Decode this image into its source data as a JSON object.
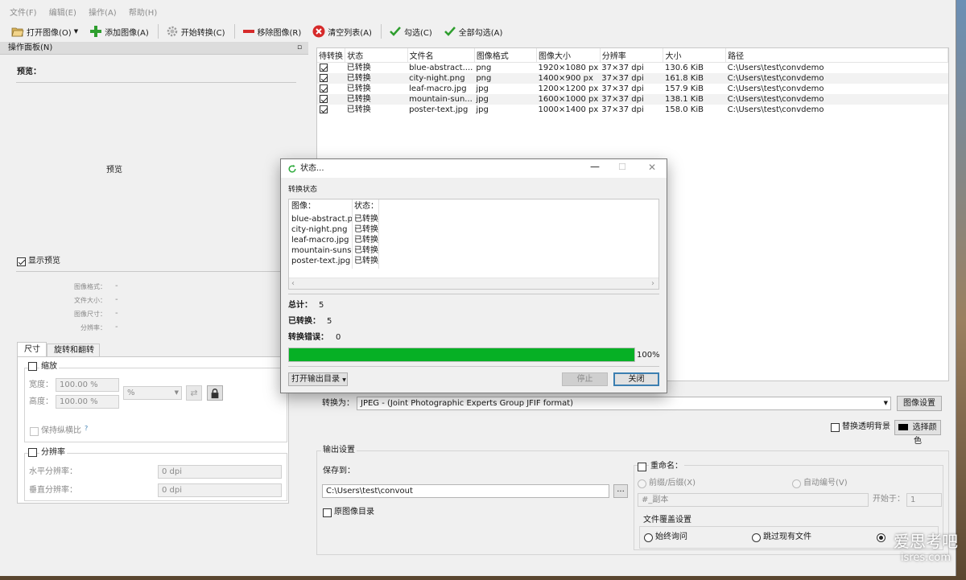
{
  "menu": [
    "文件(F)",
    "编辑(E)",
    "操作(A)",
    "帮助(H)"
  ],
  "toolbar": {
    "open": "打开图像(O)",
    "add": "添加图像(A)",
    "start": "开始转换(C)",
    "remove": "移除图像(R)",
    "clear": "清空列表(A)",
    "check": "勾选(C)",
    "check_all": "全部勾选(A)"
  },
  "panel": {
    "title": "操作面板(N)",
    "preview_heading": "预览：",
    "preview_placeholder": "预览",
    "show_preview": "显示预览",
    "info": [
      {
        "label": "图像格式：",
        "value": "-"
      },
      {
        "label": "文件大小：",
        "value": "-"
      },
      {
        "label": "图像尺寸：",
        "value": "-"
      },
      {
        "label": "分辨率：",
        "value": "-"
      }
    ],
    "tabs": [
      "尺寸",
      "旋转和翻转"
    ],
    "resize": {
      "title": "缩放",
      "width_label": "宽度：",
      "width_value": "100.00 %",
      "height_label": "高度：",
      "height_value": "100.00 %",
      "unit": "%",
      "keep_ratio": "保持纵横比",
      "help": "?"
    },
    "resolution": {
      "title": "分辨率",
      "h_label": "水平分辨率：",
      "h_value": "0 dpi",
      "v_label": "垂直分辨率：",
      "v_value": "0 dpi"
    }
  },
  "file_table": {
    "columns": [
      "待转换",
      "状态",
      "文件名",
      "图像格式",
      "图像大小",
      "分辨率",
      "大小",
      "路径"
    ],
    "rows": [
      {
        "status": "已转换",
        "name": "blue-abstract....",
        "format": "png",
        "size": "1920×1080 px",
        "dpi": "37×37 dpi",
        "bytes": "130.6 KiB",
        "path": "C:\\Users\\test\\convdemo"
      },
      {
        "status": "已转换",
        "name": "city-night.png",
        "format": "png",
        "size": "1400×900 px",
        "dpi": "37×37 dpi",
        "bytes": "161.8 KiB",
        "path": "C:\\Users\\test\\convdemo"
      },
      {
        "status": "已转换",
        "name": "leaf-macro.jpg",
        "format": "jpg",
        "size": "1200×1200 px",
        "dpi": "37×37 dpi",
        "bytes": "157.9 KiB",
        "path": "C:\\Users\\test\\convdemo"
      },
      {
        "status": "已转换",
        "name": "mountain-sun...",
        "format": "jpg",
        "size": "1600×1000 px",
        "dpi": "37×37 dpi",
        "bytes": "138.1 KiB",
        "path": "C:\\Users\\test\\convdemo"
      },
      {
        "status": "已转换",
        "name": "poster-text.jpg",
        "format": "jpg",
        "size": "1000×1400 px",
        "dpi": "37×37 dpi",
        "bytes": "158.0 KiB",
        "path": "C:\\Users\\test\\convdemo"
      }
    ]
  },
  "convert": {
    "label": "转换为：",
    "value": "JPEG - (Joint Photographic Experts Group JFIF format)",
    "image_settings": "图像设置",
    "replace_bg": "替换透明背景",
    "pick_color": "选择颜色"
  },
  "output": {
    "title": "输出设置",
    "save_to": "保存到：",
    "path": "C:\\Users\\test\\convout",
    "browse": "...",
    "orig_dir": "原图像目录",
    "rename": "重命名：",
    "prefix_suffix": "前缀/后缀(X)",
    "auto_number": "自动编号(V)",
    "name_pattern": "#_副本",
    "start_at": "开始于：",
    "start_value": "1",
    "overwrite_title": "文件覆盖设置",
    "always_ask": "始终询问",
    "skip_existing": "跳过现有文件"
  },
  "dialog": {
    "title": "状态...",
    "section": "转换状态",
    "col_image": "图像：",
    "col_status": "状态：",
    "items": [
      {
        "name": "blue-abstract.png",
        "status": "已转换"
      },
      {
        "name": "city-night.png",
        "status": "已转换"
      },
      {
        "name": "leaf-macro.jpg",
        "status": "已转换"
      },
      {
        "name": "mountain-sunset",
        "status": "已转换"
      },
      {
        "name": "poster-text.jpg",
        "status": "已转换"
      }
    ],
    "total_label": "总计：",
    "total": "5",
    "converted_label": "已转换：",
    "converted": "5",
    "errors_label": "转换错误：",
    "errors": "0",
    "progress": 1.0,
    "progress_text": "100%",
    "open_dir": "打开输出目录",
    "stop": "停止",
    "close": "关闭"
  },
  "watermark": {
    "cn": "爱思考吧",
    "en": "isres.com"
  },
  "colors": {
    "progress": "#06b025",
    "selection": "#cce8ff",
    "accent": "#3c7fb1"
  }
}
